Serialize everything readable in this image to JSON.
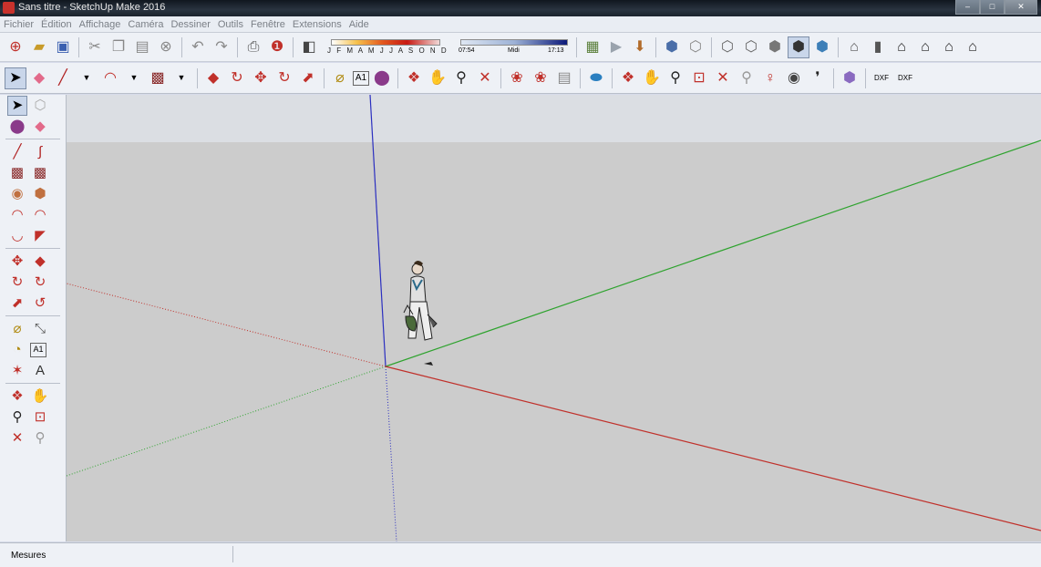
{
  "window": {
    "title": "Sans titre - SketchUp Make 2016",
    "minimize": "–",
    "maximize": "□",
    "close": "✕"
  },
  "menu": [
    "Fichier",
    "Édition",
    "Affichage",
    "Caméra",
    "Dessiner",
    "Outils",
    "Fenêtre",
    "Extensions",
    "Aide"
  ],
  "shadow_settings": {
    "months": "J F M A M J J A S O N D",
    "time_start": "07:54",
    "time_mid": "Midi",
    "time_end": "17:13"
  },
  "status": {
    "measurements_label": "Mesures",
    "measurements_value": ""
  },
  "axes_colors": {
    "red": "#c0302a",
    "green": "#2ea32e",
    "blue": "#2b2fc0"
  },
  "icons_row1": [
    "new-model-icon",
    "open-icon",
    "save-icon",
    "cut-icon",
    "copy-icon",
    "paste-icon",
    "erase-icon",
    "undo-icon",
    "redo-icon",
    "print-icon",
    "model-info-icon",
    "shadows-toggle-icon",
    "shadow-settings",
    "time-slider",
    "photo-textures-icon",
    "add-location-icon",
    "get-models-icon",
    "xray-icon",
    "back-edges-icon",
    "wireframe-icon",
    "hidden-line-icon",
    "shaded-icon",
    "shaded-textures-icon",
    "monochrome-icon",
    "iso-view-icon",
    "top-view-icon",
    "front-view-icon",
    "right-view-icon",
    "back-view-icon",
    "left-view-icon"
  ],
  "icons_row2": [
    "select-icon",
    "eraser-icon",
    "line-icon",
    "arc-icon",
    "rectangle-icon",
    "push-pull-icon",
    "follow-me-icon",
    "move-icon",
    "rotate-icon",
    "scale-icon",
    "tape-measure-icon",
    "text-icon",
    "paint-bucket-icon",
    "orbit-icon",
    "pan-icon",
    "zoom-icon",
    "zoom-extents-icon",
    "3d-warehouse-icon",
    "share-model-icon",
    "extension-warehouse-icon",
    "sandbox-icon",
    "orbit2-icon",
    "pan2-icon",
    "zoom2-icon",
    "zoom-window-icon",
    "zoom-extents2-icon",
    "previous-view-icon",
    "position-camera-icon",
    "look-around-icon",
    "walk-icon",
    "section-plane-icon",
    "import-dxf-icon",
    "export-dxf-icon"
  ]
}
